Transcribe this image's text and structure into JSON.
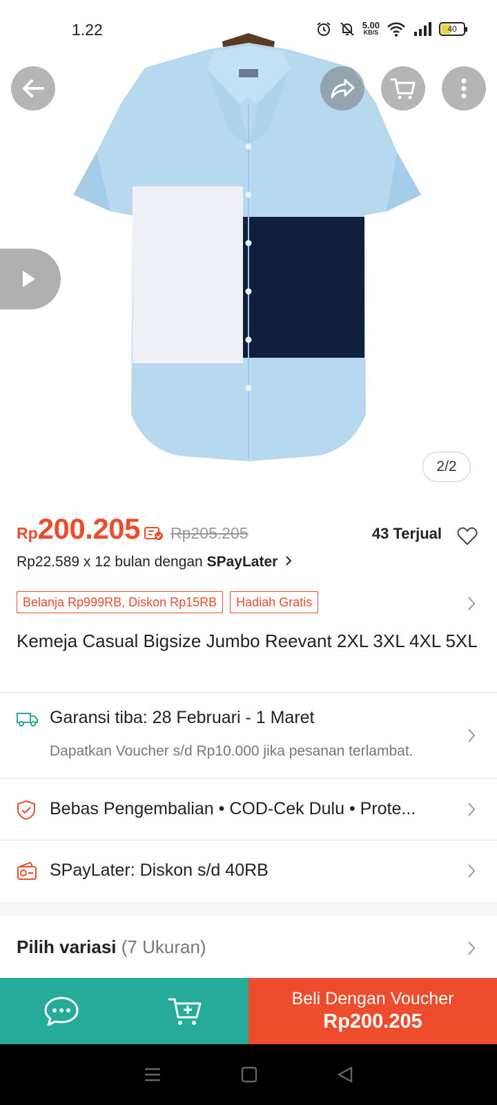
{
  "status_bar": {
    "time": "1.22",
    "net_speed_value": "5.00",
    "net_speed_unit": "KB/S",
    "battery": "40"
  },
  "image": {
    "counter": "2/2"
  },
  "price": {
    "currency": "Rp",
    "value": "200.205",
    "original": "Rp205.205",
    "sold": "43 Terjual",
    "installment_prefix": "Rp22.589 x 12 bulan dengan ",
    "installment_brand": "SPayLater"
  },
  "promo_tags": [
    {
      "label": "Belanja Rp999RB, Diskon Rp15RB"
    },
    {
      "label": "Hadiah Gratis"
    }
  ],
  "product_title": "Kemeja Casual Bigsize Jumbo Reevant 2XL 3XL 4XL 5XL",
  "shipping": {
    "title": "Garansi tiba: 28 Februari - 1 Maret",
    "subtitle": "Dapatkan Voucher s/d Rp10.000 jika pesanan terlambat."
  },
  "guarantees": "Bebas Pengembalian  •  COD-Cek Dulu  •  Prote...",
  "spaylater_promo": "SPayLater: Diskon s/d 40RB",
  "variation": {
    "label": "Pilih variasi",
    "count": "(7 Ukuran)"
  },
  "action_bar": {
    "buy_label": "Beli Dengan Voucher",
    "buy_price": "Rp200.205"
  },
  "colors": {
    "accent": "#ee4d2d",
    "teal": "#26aa99",
    "shirt_light_blue": "#b5d8ef",
    "shirt_navy": "#101f3c"
  }
}
